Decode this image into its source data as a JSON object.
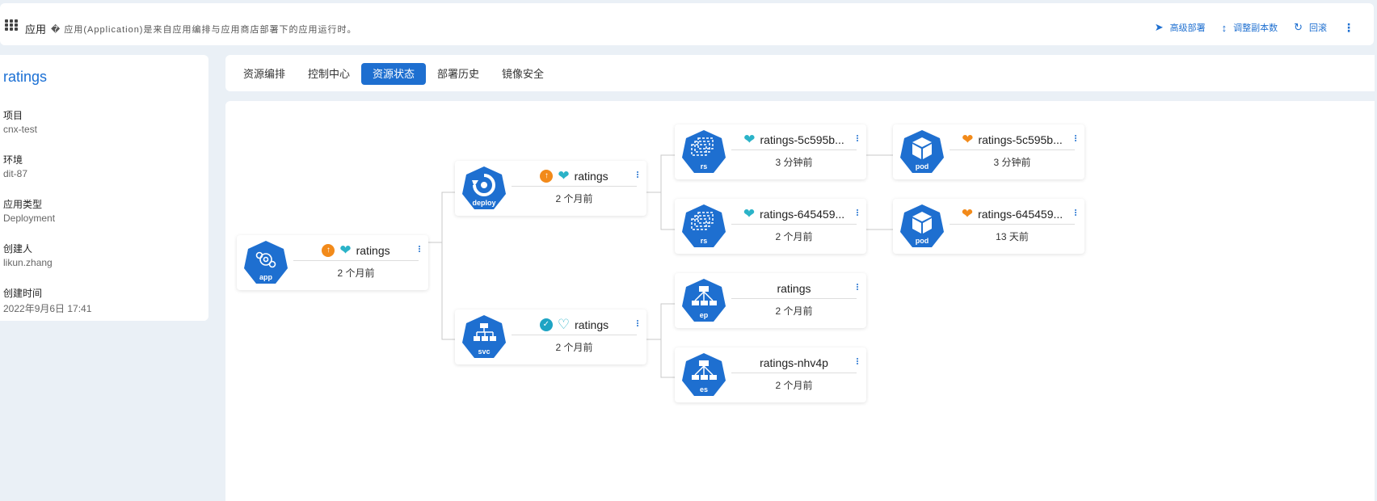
{
  "header": {
    "title": "应用",
    "description": "� 应用(Application)是来自应用编排与应用商店部署下的应用运行时。",
    "actions": [
      {
        "label": "高级部署",
        "icon": "send-icon"
      },
      {
        "label": "调整副本数",
        "icon": "updown-arrow-icon"
      },
      {
        "label": "回滚",
        "icon": "rollback-icon"
      }
    ]
  },
  "info": {
    "name": "ratings",
    "fields": [
      {
        "label": "项目",
        "value": "cnx-test"
      },
      {
        "label": "环境",
        "value": "dit-87"
      },
      {
        "label": "应用类型",
        "value": "Deployment"
      },
      {
        "label": "创建人",
        "value": "likun.zhang"
      },
      {
        "label": "创建时间",
        "value": "2022年9月6日 17:41"
      }
    ]
  },
  "tabs": [
    {
      "label": "资源编排",
      "active": false
    },
    {
      "label": "控制中心",
      "active": false
    },
    {
      "label": "资源状态",
      "active": true
    },
    {
      "label": "部署历史",
      "active": false
    },
    {
      "label": "镜像安全",
      "active": false
    }
  ],
  "colors": {
    "accent": "#1e6fd0",
    "healthy": "#2bb3c8",
    "degraded": "#f28a1a"
  },
  "nodes": [
    {
      "id": "app",
      "kind": "app",
      "name": "ratings",
      "time": "2 个月前",
      "sync": "out-of-sync",
      "health": "healthy"
    },
    {
      "id": "deploy",
      "kind": "deploy",
      "name": "ratings",
      "time": "2 个月前",
      "sync": "out-of-sync",
      "health": "healthy"
    },
    {
      "id": "svc",
      "kind": "svc",
      "name": "ratings",
      "time": "2 个月前",
      "sync": "synced",
      "health": "progressing"
    },
    {
      "id": "rs1",
      "kind": "rs",
      "name": "ratings-5c595b...",
      "time": "3 分钟前",
      "health": "healthy"
    },
    {
      "id": "rs2",
      "kind": "rs",
      "name": "ratings-645459...",
      "time": "2 个月前",
      "health": "healthy"
    },
    {
      "id": "ep",
      "kind": "ep",
      "name": "ratings",
      "time": "2 个月前"
    },
    {
      "id": "es",
      "kind": "es",
      "name": "ratings-nhv4p",
      "time": "2 个月前"
    },
    {
      "id": "pod1",
      "kind": "pod",
      "name": "ratings-5c595b...",
      "time": "3 分钟前",
      "health": "degraded"
    },
    {
      "id": "pod2",
      "kind": "pod",
      "name": "ratings-645459...",
      "time": "13 天前",
      "health": "degraded"
    }
  ]
}
